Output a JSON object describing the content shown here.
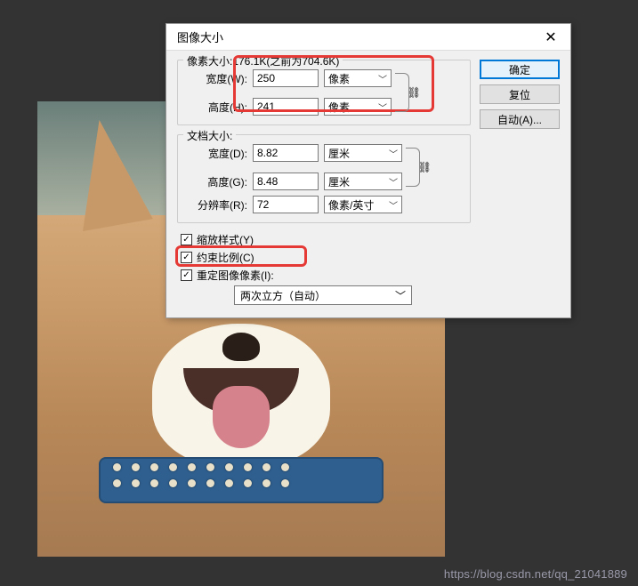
{
  "dialog": {
    "title": "图像大小",
    "close": "✕"
  },
  "buttons": {
    "ok": "确定",
    "reset": "复位",
    "auto": "自动(A)..."
  },
  "pixel_dim": {
    "legend": "像素大小:176.1K(之前为704.6K)",
    "width_label": "宽度(W):",
    "width_value": "250",
    "width_unit": "像素",
    "height_label": "高度(H):",
    "height_value": "241",
    "height_unit": "像素",
    "link": "⛓"
  },
  "doc_size": {
    "legend": "文档大小:",
    "width_label": "宽度(D):",
    "width_value": "8.82",
    "width_unit": "厘米",
    "height_label": "高度(G):",
    "height_value": "8.48",
    "height_unit": "厘米",
    "res_label": "分辨率(R):",
    "res_value": "72",
    "res_unit": "像素/英寸",
    "link": "⛓"
  },
  "checks": {
    "scale_styles": "缩放样式(Y)",
    "constrain": "约束比例(C)",
    "resample": "重定图像像素(I):"
  },
  "resample_method": "两次立方（自动）",
  "watermark": "https://blog.csdn.net/qq_21041889",
  "accent_red": "#e53935"
}
